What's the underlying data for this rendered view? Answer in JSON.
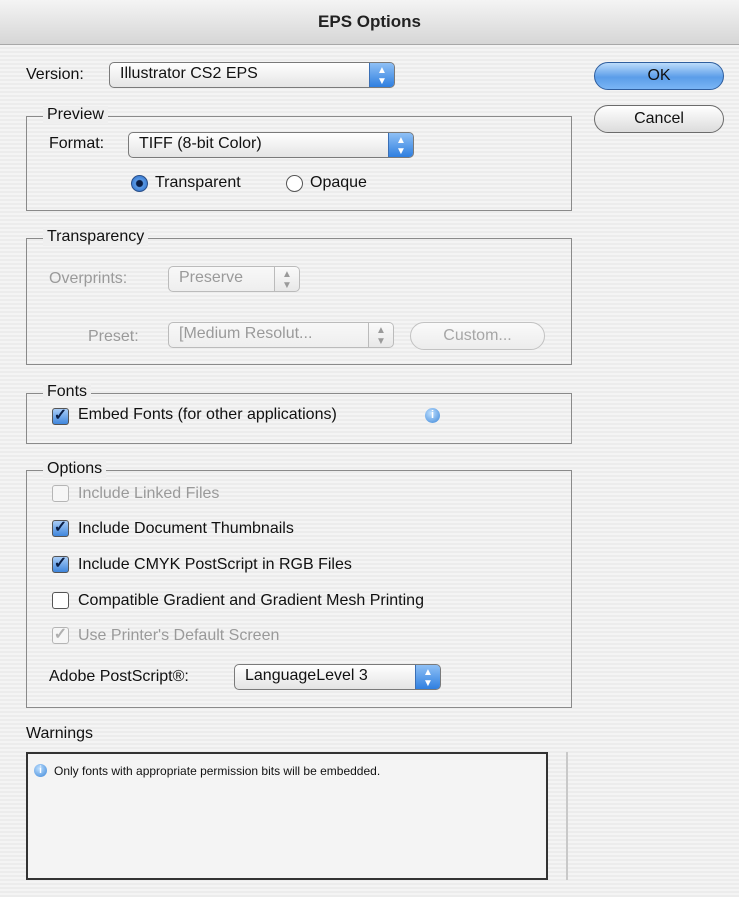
{
  "window": {
    "title": "EPS Options"
  },
  "version": {
    "label": "Version:",
    "value": "Illustrator CS2 EPS"
  },
  "buttons": {
    "ok": "OK",
    "cancel": "Cancel"
  },
  "preview": {
    "legend": "Preview",
    "format_label": "Format:",
    "format_value": "TIFF (8-bit Color)",
    "transparent": "Transparent",
    "opaque": "Opaque",
    "selected": "Transparent"
  },
  "transparency": {
    "legend": "Transparency",
    "overprints_label": "Overprints:",
    "overprints_value": "Preserve",
    "preset_label": "Preset:",
    "preset_value": "[Medium Resolut...",
    "custom_button": "Custom..."
  },
  "fonts": {
    "legend": "Fonts",
    "embed_label": "Embed Fonts (for other applications)",
    "embed_checked": true
  },
  "options": {
    "legend": "Options",
    "items": [
      {
        "label": "Include Linked Files",
        "checked": false,
        "enabled": false
      },
      {
        "label": "Include Document Thumbnails",
        "checked": true,
        "enabled": true
      },
      {
        "label": "Include CMYK PostScript in RGB Files",
        "checked": true,
        "enabled": true
      },
      {
        "label": "Compatible Gradient and Gradient Mesh Printing",
        "checked": false,
        "enabled": true
      },
      {
        "label": "Use Printer's Default Screen",
        "checked": true,
        "enabled": false
      }
    ],
    "postscript_label": "Adobe PostScript®:",
    "postscript_value": "LanguageLevel 3"
  },
  "warnings": {
    "label": "Warnings",
    "message": "Only fonts with appropriate permission bits will be embedded."
  },
  "icons": {
    "popup_arrows": "up-down-arrows-icon",
    "info": "info-icon",
    "check": "checkmark-icon"
  }
}
